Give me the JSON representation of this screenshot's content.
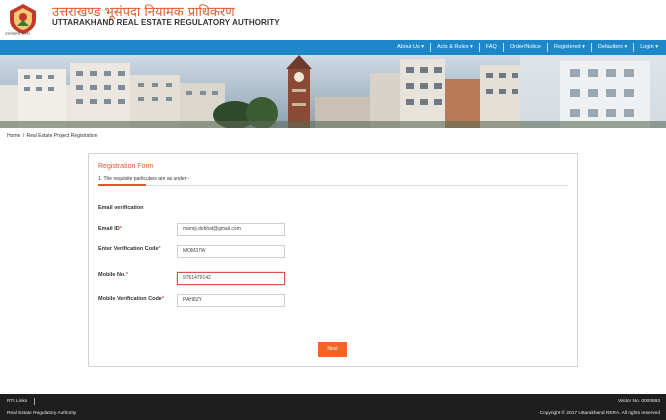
{
  "header": {
    "title_hindi": "उत्तराखण्ड भूसंपदा नियामक प्राधिकरण",
    "title_english": "UTTARAKHAND REAL ESTATE REGULATORY AUTHORITY",
    "logo_caption": "उत्तराखण्ड शासन"
  },
  "nav": {
    "items": [
      {
        "label": "About Us ▾"
      },
      {
        "label": "Acts & Rules ▾"
      },
      {
        "label": "FAQ"
      },
      {
        "label": "Order/Notice"
      },
      {
        "label": "Registered ▾"
      },
      {
        "label": "Defaulters ▾"
      },
      {
        "label": "Login ▾"
      }
    ]
  },
  "breadcrumb": {
    "home": "Home",
    "separator": "/",
    "current": "Real Estate Project Registration"
  },
  "form": {
    "title": "Registration Form",
    "subtitle": "1. The requisite particulars are as under:-",
    "section_title": "Email verification",
    "required_mark": "*",
    "email_label": "Email ID",
    "email_value": "manoj.dobhal@gmail.com",
    "verification_label": "Enter Verification Code",
    "verification_value": "MOM37W",
    "mobile_label": "Mobile No.",
    "mobile_value": "9761479142",
    "mobile_verification_label": "Mobile Verification Code",
    "mobile_verification_value": "PAH8ZY",
    "next_button": "Next"
  },
  "footer": {
    "rti_links": "RTI Links",
    "org_name": "Real Estate Regulatory Authority",
    "visitor": "Visitor No. 0000893",
    "copyright": "Copyright © 2017 Uttarakhand RERA. All rights reserved"
  },
  "colors": {
    "nav_bg": "#1c87c9",
    "accent_orange": "#f26522",
    "title_orange": "#e0592a",
    "footer_bg": "#1e1e1e",
    "error_red": "#d9534f"
  }
}
